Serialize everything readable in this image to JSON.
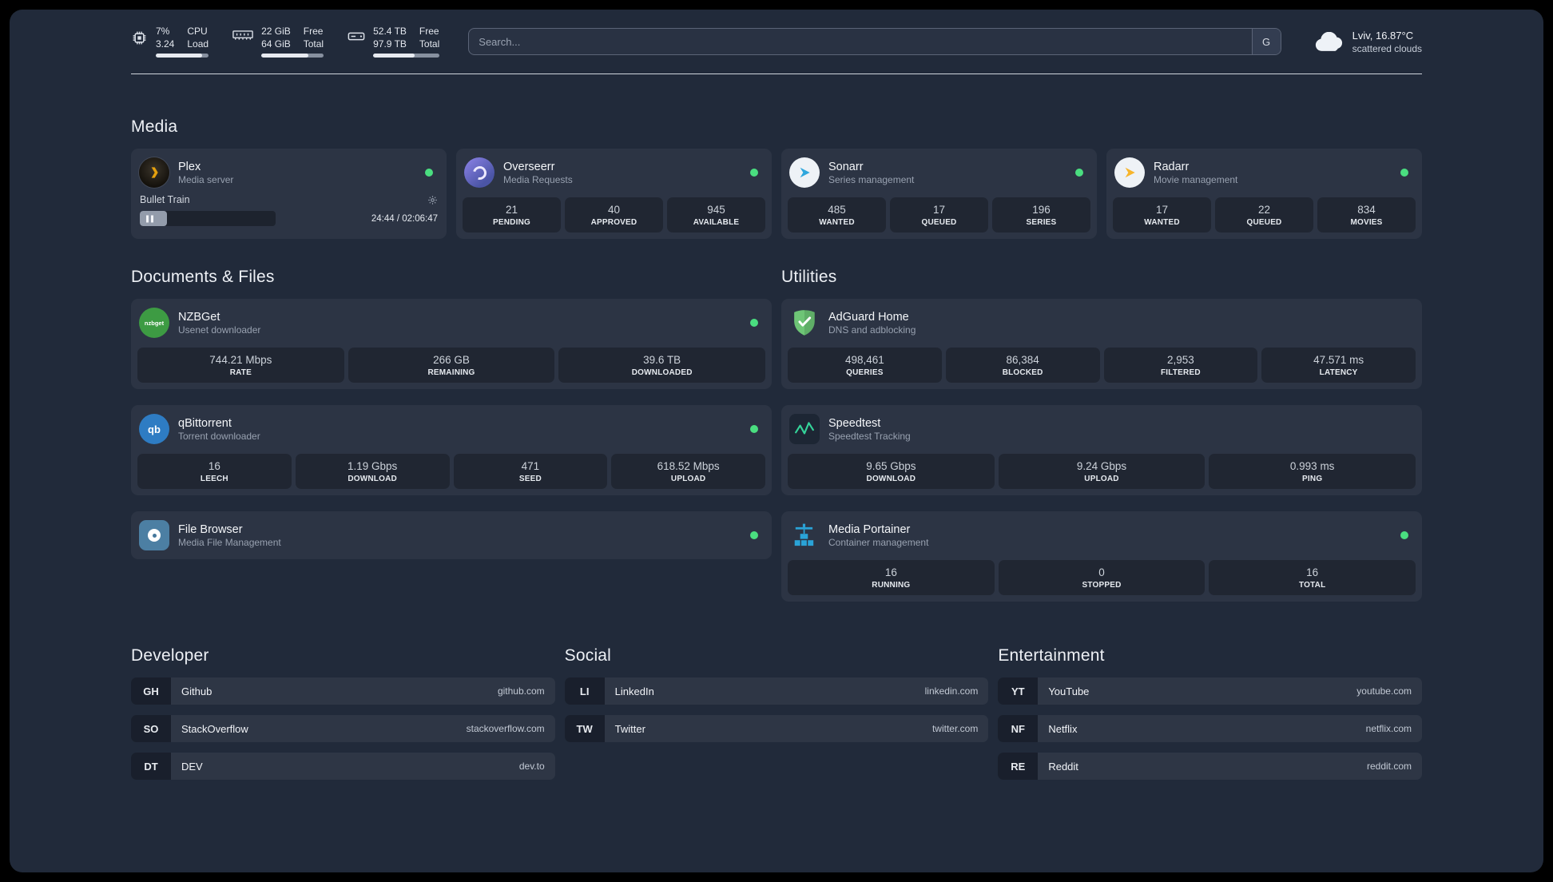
{
  "colors": {
    "status_online": "#4ade80"
  },
  "topbar": {
    "cpu": {
      "icon": "cpu-chip-icon",
      "value1": "7%",
      "value2": "3.24",
      "label1": "CPU",
      "label2": "Load",
      "bar_style": "width:88%"
    },
    "memory": {
      "icon": "ram-icon",
      "value1": "22 GiB",
      "value2": "64 GiB",
      "label1": "Free",
      "label2": "Total",
      "bar_style": "width:75%"
    },
    "disk": {
      "icon": "hard-drive-icon",
      "value1": "52.4 TB",
      "value2": "97.9 TB",
      "label1": "Free",
      "label2": "Total",
      "bar_style": "width:62%"
    },
    "search": {
      "placeholder": "Search...",
      "provider_button": "G"
    },
    "weather": {
      "icon": "cloud-icon",
      "location": "Lviv, 16.87°C",
      "condition": "scattered clouds"
    }
  },
  "sections": {
    "media": "Media",
    "documents": "Documents & Files",
    "utilities": "Utilities",
    "developer": "Developer",
    "social": "Social",
    "entertainment": "Entertainment"
  },
  "services": {
    "plex": {
      "icon": "plex-icon",
      "name": "Plex",
      "desc": "Media server",
      "now_playing": "Bullet Train",
      "time": "24:44 / 02:06:47",
      "progress_style": "width:20%"
    },
    "overseerr": {
      "icon": "overseerr-icon",
      "name": "Overseerr",
      "desc": "Media Requests",
      "stats": [
        {
          "value": "21",
          "label": "PENDING"
        },
        {
          "value": "40",
          "label": "APPROVED"
        },
        {
          "value": "945",
          "label": "AVAILABLE"
        }
      ]
    },
    "sonarr": {
      "icon": "sonarr-icon",
      "name": "Sonarr",
      "desc": "Series management",
      "stats": [
        {
          "value": "485",
          "label": "WANTED"
        },
        {
          "value": "17",
          "label": "QUEUED"
        },
        {
          "value": "196",
          "label": "SERIES"
        }
      ]
    },
    "radarr": {
      "icon": "radarr-icon",
      "name": "Radarr",
      "desc": "Movie management",
      "stats": [
        {
          "value": "17",
          "label": "WANTED"
        },
        {
          "value": "22",
          "label": "QUEUED"
        },
        {
          "value": "834",
          "label": "MOVIES"
        }
      ]
    },
    "nzbget": {
      "icon": "nzbget-icon",
      "name": "NZBGet",
      "desc": "Usenet downloader",
      "stats": [
        {
          "value": "744.21 Mbps",
          "label": "RATE"
        },
        {
          "value": "266 GB",
          "label": "REMAINING"
        },
        {
          "value": "39.6 TB",
          "label": "DOWNLOADED"
        }
      ]
    },
    "qbittorrent": {
      "icon": "qbittorrent-icon",
      "name": "qBittorrent",
      "desc": "Torrent downloader",
      "stats": [
        {
          "value": "16",
          "label": "LEECH"
        },
        {
          "value": "1.19 Gbps",
          "label": "DOWNLOAD"
        },
        {
          "value": "471",
          "label": "SEED"
        },
        {
          "value": "618.52 Mbps",
          "label": "UPLOAD"
        }
      ]
    },
    "filebrowser": {
      "icon": "filebrowser-icon",
      "name": "File Browser",
      "desc": "Media File Management"
    },
    "adguard": {
      "icon": "adguard-shield-icon",
      "name": "AdGuard Home",
      "desc": "DNS and adblocking",
      "stats": [
        {
          "value": "498,461",
          "label": "QUERIES"
        },
        {
          "value": "86,384",
          "label": "BLOCKED"
        },
        {
          "value": "2,953",
          "label": "FILTERED"
        },
        {
          "value": "47.571 ms",
          "label": "LATENCY"
        }
      ]
    },
    "speedtest": {
      "icon": "speedtest-graph-icon",
      "name": "Speedtest",
      "desc": "Speedtest Tracking",
      "stats": [
        {
          "value": "9.65 Gbps",
          "label": "DOWNLOAD"
        },
        {
          "value": "9.24 Gbps",
          "label": "UPLOAD"
        },
        {
          "value": "0.993 ms",
          "label": "PING"
        }
      ]
    },
    "portainer": {
      "icon": "portainer-crane-icon",
      "name": "Media Portainer",
      "desc": "Container management",
      "stats": [
        {
          "value": "16",
          "label": "RUNNING"
        },
        {
          "value": "0",
          "label": "STOPPED"
        },
        {
          "value": "16",
          "label": "TOTAL"
        }
      ]
    }
  },
  "bookmarks": {
    "developer": [
      {
        "abbr": "GH",
        "name": "Github",
        "url": "github.com"
      },
      {
        "abbr": "SO",
        "name": "StackOverflow",
        "url": "stackoverflow.com"
      },
      {
        "abbr": "DT",
        "name": "DEV",
        "url": "dev.to"
      }
    ],
    "social": [
      {
        "abbr": "LI",
        "name": "LinkedIn",
        "url": "linkedin.com"
      },
      {
        "abbr": "TW",
        "name": "Twitter",
        "url": "twitter.com"
      }
    ],
    "entertainment": [
      {
        "abbr": "YT",
        "name": "YouTube",
        "url": "youtube.com"
      },
      {
        "abbr": "NF",
        "name": "Netflix",
        "url": "netflix.com"
      },
      {
        "abbr": "RE",
        "name": "Reddit",
        "url": "reddit.com"
      }
    ]
  }
}
